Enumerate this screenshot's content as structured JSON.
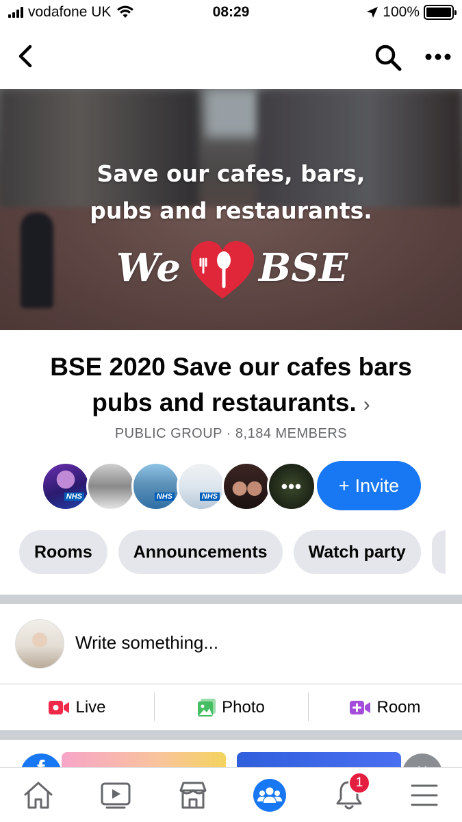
{
  "status_bar": {
    "carrier": "vodafone UK",
    "time": "08:29",
    "battery": "100%",
    "icons": [
      "signal-icon",
      "wifi-icon",
      "location-arrow-icon",
      "battery-icon"
    ]
  },
  "nav": {
    "icons": [
      "back-chevron-icon",
      "search-icon",
      "more-icon"
    ]
  },
  "cover": {
    "line1": "Save our cafes, bars,",
    "line2": "pubs and restaurants.",
    "logo_left": "We",
    "logo_right": "BSE",
    "logo_heart_color": "#e0273a"
  },
  "group": {
    "title": "BSE 2020 Save our cafes bars pubs and restaurants.",
    "chevron": "›",
    "meta": "PUBLIC GROUP · 8,184 MEMBERS",
    "avatar_badges": [
      "NHS",
      "NHS",
      "NHS"
    ],
    "more_avatars": "•••",
    "invite_label": "Invite",
    "invite_plus": "+"
  },
  "chips": [
    "Rooms",
    "Announcements",
    "Watch party"
  ],
  "composer": {
    "placeholder": "Write something..."
  },
  "actions": [
    {
      "label": "Live",
      "icon": "live-video-icon",
      "color": "#f02849"
    },
    {
      "label": "Photo",
      "icon": "photo-icon",
      "color": "#45bd62"
    },
    {
      "label": "Room",
      "icon": "room-video-icon",
      "color": "#a44ddb"
    }
  ],
  "tabbar": {
    "items": [
      "home-icon",
      "watch-icon",
      "marketplace-icon",
      "groups-icon",
      "notifications-icon",
      "menu-icon"
    ],
    "active": "groups-icon",
    "notification_count": "1"
  },
  "colors": {
    "accent": "#1877f2",
    "chip_bg": "#e4e6eb",
    "secondary_text": "#65676b",
    "badge": "#e41e3f"
  }
}
